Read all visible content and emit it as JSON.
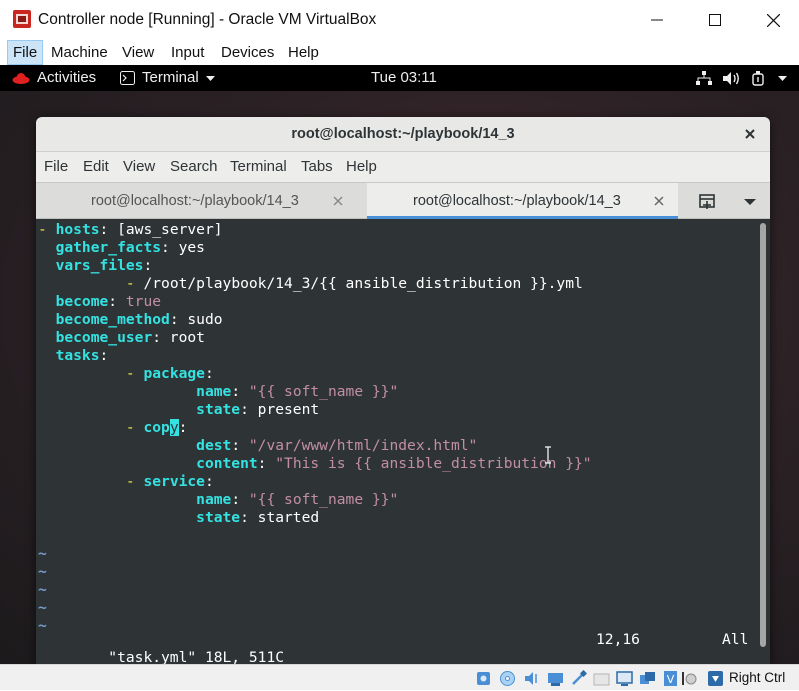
{
  "window": {
    "title": "Controller node [Running] - Oracle VM VirtualBox",
    "menu": [
      "File",
      "Machine",
      "View",
      "Input",
      "Devices",
      "Help"
    ]
  },
  "gnome": {
    "activities": "Activities",
    "app_menu": "Terminal",
    "clock": "Tue 03:11"
  },
  "terminal": {
    "title": "root@localhost:~/playbook/14_3",
    "menu": [
      "File",
      "Edit",
      "View",
      "Search",
      "Terminal",
      "Tabs",
      "Help"
    ],
    "tabs": [
      {
        "label": "root@localhost:~/playbook/14_3",
        "active": false
      },
      {
        "label": "root@localhost:~/playbook/14_3",
        "active": true
      }
    ]
  },
  "editor": {
    "lines": [
      "- hosts: [aws_server]",
      "  gather_facts: yes",
      "  vars_files:",
      "          - /root/playbook/14_3/{{ ansible_distribution }}.yml",
      "  become: true",
      "  become_method: sudo",
      "  become_user: root",
      "  tasks:",
      "          - package:",
      "                  name: \"{{ soft_name }}\"",
      "                  state: present",
      "          - copy:",
      "                  dest: \"/var/www/html/index.html\"",
      "                  content: \"This is {{ ansible_distribution }}\"",
      "          - service:",
      "                  name: \"{{ soft_name }}\"",
      "                  state: started"
    ],
    "tilde_lines": [
      "~",
      "~",
      "~",
      "~",
      "~"
    ],
    "status": {
      "file_info": "\"task.yml\" 18L, 511C",
      "position": "12,16",
      "scroll": "All"
    }
  },
  "statusbar": {
    "host_key": "Right Ctrl"
  },
  "colors": {
    "terminal_bg": "#2e3436",
    "yaml_key": "#34e2e2",
    "yaml_string": "#c28ea4",
    "tab_accent": "#4a90d9"
  }
}
